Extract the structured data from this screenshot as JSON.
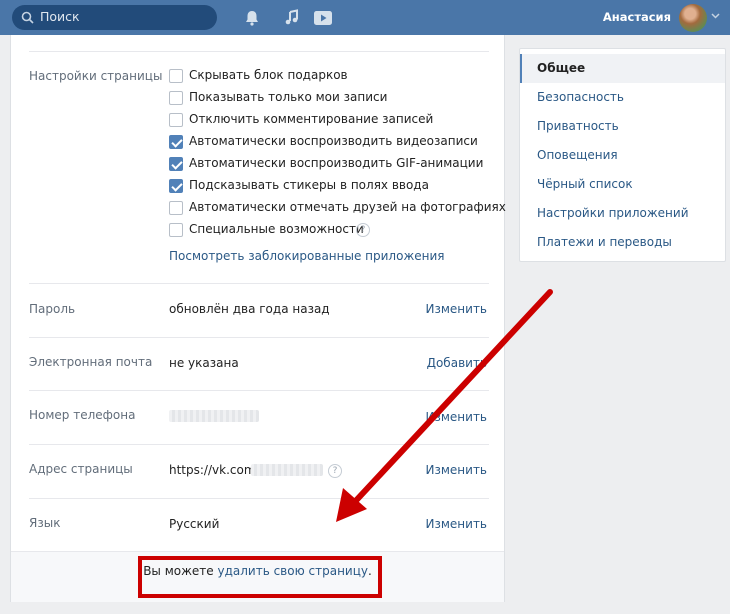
{
  "header": {
    "search_placeholder": "Поиск",
    "user_name": "Анастасия",
    "icons": [
      "search-icon",
      "bell-icon",
      "music-icon",
      "video-icon",
      "chevron-down-icon"
    ],
    "colors": {
      "bar": "#4a76a8",
      "search_bg": "#224b7a"
    }
  },
  "settings": {
    "page_settings_label": "Настройки страницы",
    "checkboxes": [
      {
        "label": "Скрывать блок подарков",
        "checked": false
      },
      {
        "label": "Показывать только мои записи",
        "checked": false
      },
      {
        "label": "Отключить комментирование записей",
        "checked": false
      },
      {
        "label": "Автоматически воспроизводить видеозаписи",
        "checked": true
      },
      {
        "label": "Автоматически воспроизводить GIF-анимации",
        "checked": true
      },
      {
        "label": "Подсказывать стикеры в полях ввода",
        "checked": true
      },
      {
        "label": "Автоматически отмечать друзей на фотографиях",
        "checked": false
      },
      {
        "label": "Специальные возможности",
        "checked": false
      }
    ],
    "blocked_apps_link": "Посмотреть заблокированные приложения",
    "rows": {
      "password": {
        "label": "Пароль",
        "value": "обновлён два года назад",
        "action": "Изменить"
      },
      "email": {
        "label": "Электронная почта",
        "value": "не указана",
        "action": "Добавить"
      },
      "phone": {
        "label": "Номер телефона",
        "action": "Изменить"
      },
      "address": {
        "label": "Адрес страницы",
        "value": "https://vk.com/",
        "action": "Изменить"
      },
      "language": {
        "label": "Язык",
        "value": "Русский",
        "action": "Изменить"
      }
    },
    "help_mark": "?",
    "footer": {
      "prefix": "Вы можете ",
      "link": "удалить свою страницу",
      "suffix": "."
    }
  },
  "nav": {
    "items": [
      "Общее",
      "Безопасность",
      "Приватность",
      "Оповещения",
      "Чёрный список",
      "Настройки приложений",
      "Платежи и переводы"
    ],
    "active": 0
  },
  "annotation": {
    "color": "#cc0000"
  }
}
